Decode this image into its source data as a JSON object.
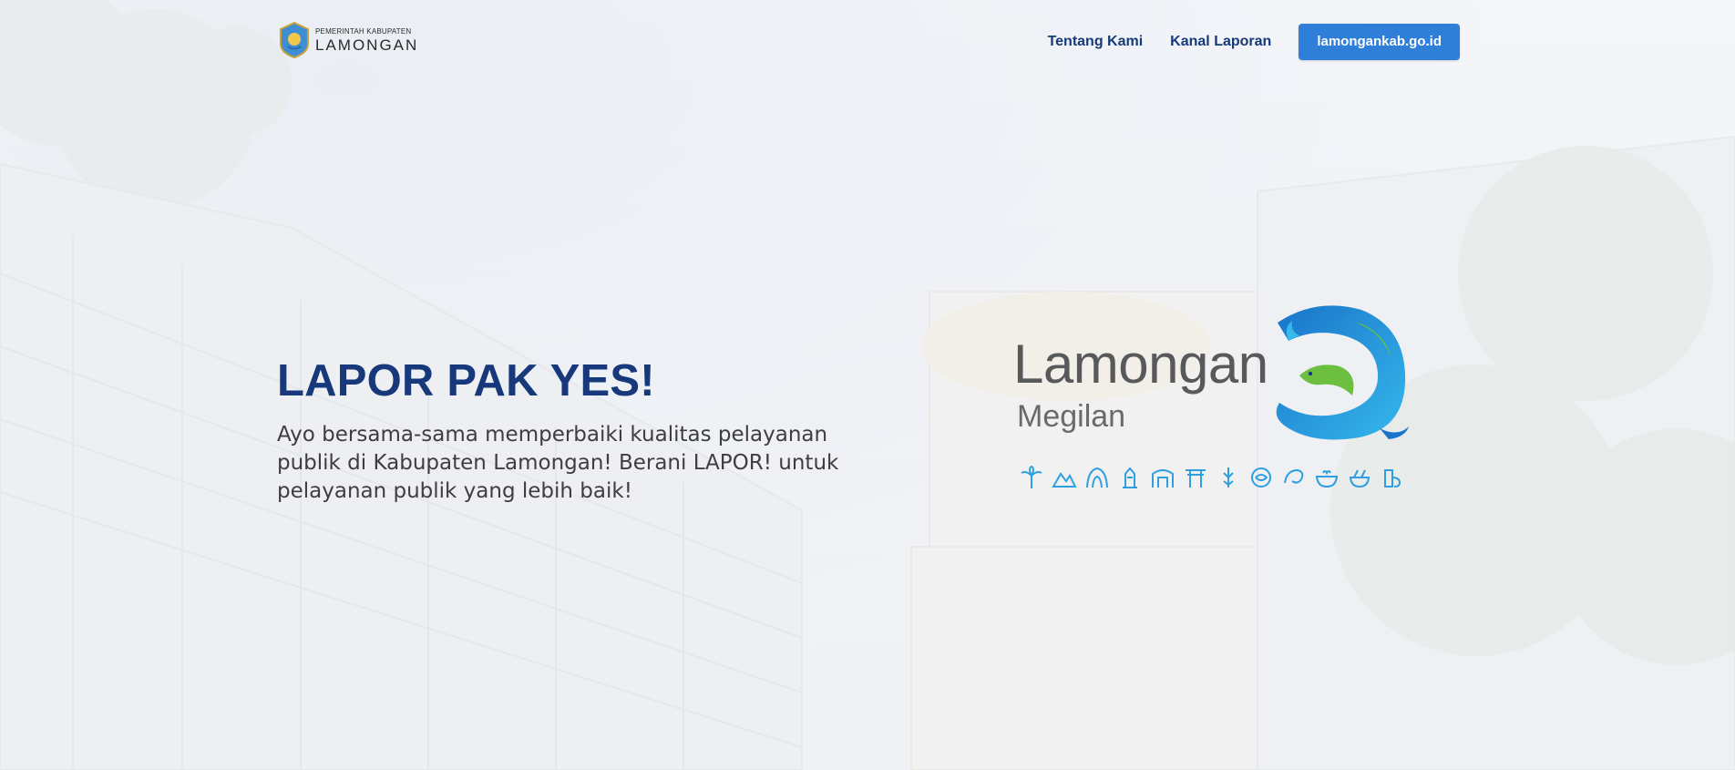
{
  "header": {
    "logo": {
      "line1": "PEMERINTAH KABUPATEN",
      "line2": "LAMONGAN"
    },
    "nav": {
      "about_label": "Tentang Kami",
      "channel_label": "Kanal Laporan",
      "site_button_label": "lamongankab.go.id"
    }
  },
  "hero": {
    "title": "LAPOR PAK YES!",
    "description": "Ayo bersama-sama memperbaiki kualitas pelayanan publik di Kabupaten Lamongan! Berani LAPOR! untuk pelayanan publik yang lebih baik!"
  },
  "brand": {
    "name": "Lamongan",
    "tagline": "Megilan",
    "icons": [
      "palm-tree-icon",
      "hill-icon",
      "cave-icon",
      "monument-icon",
      "gate-icon",
      "torii-icon",
      "candle-icon",
      "dragon-icon",
      "fish-icon",
      "bowl-icon",
      "food-bowl-icon",
      "drink-icon"
    ]
  },
  "colors": {
    "title": "#17387a",
    "nav_link": "#173a78",
    "button_bg": "#2f7fd8",
    "brand_blue": "#1e8fd6",
    "brand_green": "#6cbf3f"
  }
}
